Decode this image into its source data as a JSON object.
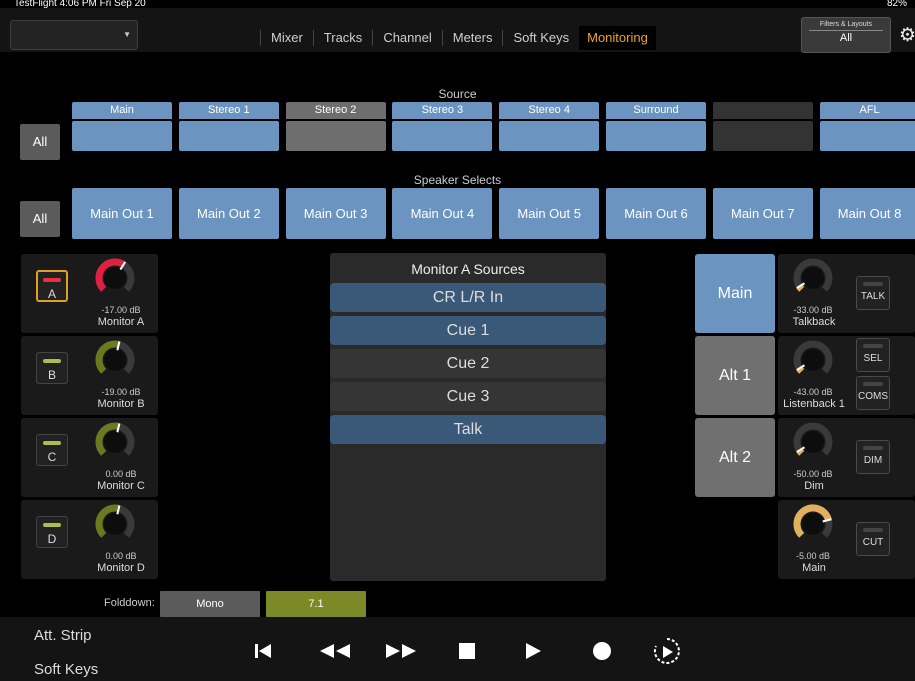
{
  "status": {
    "left": "TestFlight  4:06 PM  Fri Sep 20",
    "right": "82%"
  },
  "nav": {
    "tabs": [
      {
        "label": "Mixer"
      },
      {
        "label": "Tracks"
      },
      {
        "label": "Channel"
      },
      {
        "label": "Meters"
      },
      {
        "label": "Soft Keys"
      },
      {
        "label": "Monitoring"
      }
    ],
    "active": "Monitoring",
    "filters": {
      "title": "Filters & Layouts",
      "value": "All"
    }
  },
  "source": {
    "title": "Source",
    "all_label": "All",
    "items": [
      {
        "label": "Main",
        "color": "#6b94c0"
      },
      {
        "label": "Stereo 1",
        "color": "#6b94c0"
      },
      {
        "label": "Stereo 2",
        "color": "#6e6e6e"
      },
      {
        "label": "Stereo 3",
        "color": "#6b94c0"
      },
      {
        "label": "Stereo 4",
        "color": "#6b94c0"
      },
      {
        "label": "Surround",
        "color": "#6b94c0"
      },
      {
        "label": "",
        "color": "#333333"
      },
      {
        "label": "AFL",
        "color": "#6b94c0"
      }
    ]
  },
  "speakers": {
    "title": "Speaker Selects",
    "all_label": "All",
    "items": [
      "Main Out 1",
      "Main Out 2",
      "Main Out 3",
      "Main Out 4",
      "Main Out 5",
      "Main Out 6",
      "Main Out 7",
      "Main Out 8"
    ]
  },
  "monitors": [
    {
      "letter": "A",
      "db": "-17.00 dB",
      "name": "Monitor A",
      "led": "#e83040",
      "knob_color": "#e02040",
      "level": 0.62
    },
    {
      "letter": "B",
      "db": "-19.00 dB",
      "name": "Monitor B",
      "led": "#a8c050",
      "knob_color": "#6a7a20",
      "level": 0.55
    },
    {
      "letter": "C",
      "db": "0.00 dB",
      "name": "Monitor C",
      "led": "#a8c050",
      "knob_color": "#6a7a20",
      "level": 0.55
    },
    {
      "letter": "D",
      "db": "0.00 dB",
      "name": "Monitor D",
      "led": "#a8c050",
      "knob_color": "#6a7a20",
      "level": 0.55
    }
  ],
  "monitor_sources": {
    "title": "Monitor A Sources",
    "items": [
      {
        "label": "CR L/R In",
        "selected": true
      },
      {
        "label": "Cue 1",
        "selected": true
      },
      {
        "label": "Cue 2",
        "selected": false
      },
      {
        "label": "Cue 3",
        "selected": false
      },
      {
        "label": "Talk",
        "selected": true
      }
    ]
  },
  "outputs": [
    {
      "label": "Main",
      "active": true
    },
    {
      "label": "Alt 1",
      "active": false
    },
    {
      "label": "Alt 2",
      "active": false
    }
  ],
  "right_controls": [
    {
      "db": "-33.00 dB",
      "name": "Talkback",
      "buttons": [
        "TALK"
      ],
      "level": 0.05
    },
    {
      "db": "-43.00 dB",
      "name": "Listenback 1",
      "buttons": [
        "SEL",
        "COMS"
      ],
      "level": 0.05
    },
    {
      "db": "-50.00 dB",
      "name": "Dim",
      "buttons": [
        "DIM"
      ],
      "level": 0.05
    },
    {
      "db": "-5.00 dB",
      "name": "Main",
      "buttons": [
        "CUT"
      ],
      "level": 0.78
    }
  ],
  "folddown": {
    "label": "Folddown:",
    "options": [
      {
        "label": "Mono",
        "color": "#5b5b5b"
      },
      {
        "label": "7.1",
        "color": "#7b8a26"
      }
    ]
  },
  "bottom": {
    "att_strip": "Att. Strip",
    "soft_keys": "Soft Keys"
  }
}
